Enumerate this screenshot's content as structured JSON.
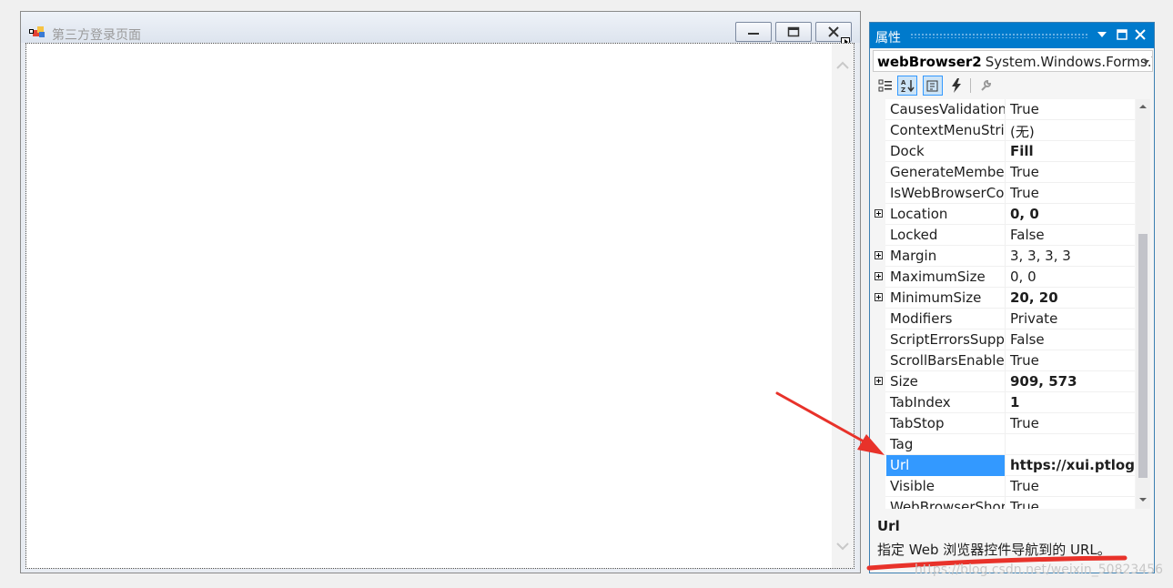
{
  "form": {
    "title": "第三方登录页面"
  },
  "properties_panel": {
    "title": "属性",
    "object_name": "webBrowser2",
    "object_type": "System.Windows.Forms.\\",
    "rows": [
      {
        "name": "CausesValidation",
        "value": "True",
        "bold": false,
        "expandable": false
      },
      {
        "name": "ContextMenuStrip",
        "value": "(无)",
        "bold": false,
        "expandable": false
      },
      {
        "name": "Dock",
        "value": "Fill",
        "bold": true,
        "expandable": false
      },
      {
        "name": "GenerateMember",
        "value": "True",
        "bold": false,
        "expandable": false
      },
      {
        "name": "IsWebBrowserContextMenuEnabled",
        "value": "True",
        "bold": false,
        "expandable": false
      },
      {
        "name": "Location",
        "value": "0, 0",
        "bold": true,
        "expandable": true
      },
      {
        "name": "Locked",
        "value": "False",
        "bold": false,
        "expandable": false
      },
      {
        "name": "Margin",
        "value": "3, 3, 3, 3",
        "bold": false,
        "expandable": true
      },
      {
        "name": "MaximumSize",
        "value": "0, 0",
        "bold": false,
        "expandable": true
      },
      {
        "name": "MinimumSize",
        "value": "20, 20",
        "bold": true,
        "expandable": true
      },
      {
        "name": "Modifiers",
        "value": "Private",
        "bold": false,
        "expandable": false
      },
      {
        "name": "ScriptErrorsSuppressed",
        "value": "False",
        "bold": false,
        "expandable": false
      },
      {
        "name": "ScrollBarsEnabled",
        "value": "True",
        "bold": false,
        "expandable": false
      },
      {
        "name": "Size",
        "value": "909, 573",
        "bold": true,
        "expandable": true
      },
      {
        "name": "TabIndex",
        "value": "1",
        "bold": true,
        "expandable": false
      },
      {
        "name": "TabStop",
        "value": "True",
        "bold": false,
        "expandable": false
      },
      {
        "name": "Tag",
        "value": "",
        "bold": false,
        "expandable": false
      },
      {
        "name": "Url",
        "value": "https://xui.ptlogin",
        "bold": true,
        "expandable": false,
        "selected": true
      },
      {
        "name": "Visible",
        "value": "True",
        "bold": false,
        "expandable": false
      },
      {
        "name": "WebBrowserShortcutsEnabled",
        "value": "True",
        "bold": false,
        "expandable": false
      }
    ],
    "description": {
      "title": "Url",
      "text": "指定 Web 浏览器控件导航到的 URL。"
    }
  },
  "watermark": "https://blog.csdn.net/weixin_50823456",
  "colors": {
    "panel_title_bg": "#007acc",
    "selection": "#3399ff",
    "annotation": "#e8322a"
  }
}
